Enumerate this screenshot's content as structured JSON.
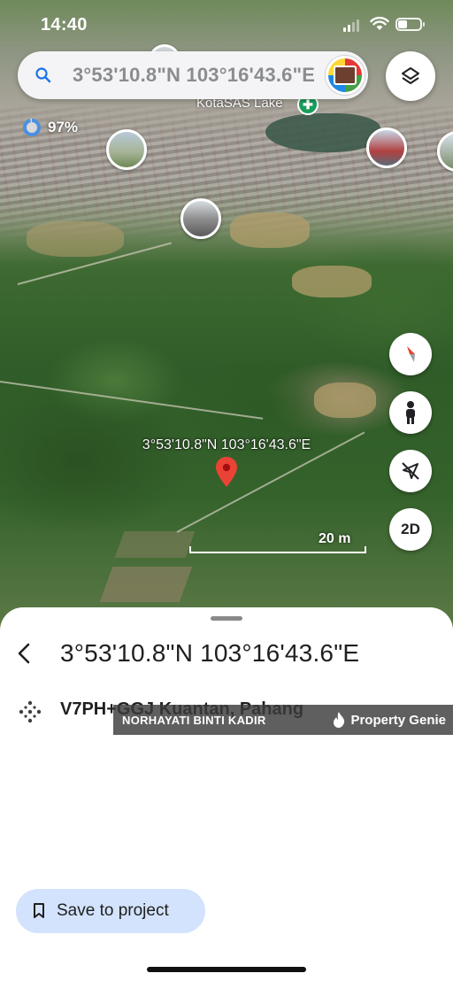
{
  "status_bar": {
    "time": "14:40",
    "battery_level": 0.4
  },
  "search": {
    "query": "3°53'10.8\"N 103°16'43.6\"E"
  },
  "map": {
    "lake_label": "KotaSAS Lake",
    "render_progress": "97%",
    "pin_coordinates": "3°53'10.8\"N 103°16'43.6\"E",
    "scale_label": "20 m",
    "view_mode_button": "2D"
  },
  "place": {
    "title": "3°53'10.8\"N 103°16'43.6\"E",
    "plus_code": "V7PH+GGJ Kuantan, Pahang"
  },
  "watermark": {
    "name": "NORHAYATI BINTI KADIR",
    "brand": "Property Genie"
  },
  "actions": {
    "save_label": "Save to project"
  },
  "icons": {
    "search": "search-icon",
    "layers": "layers-icon",
    "compass": "compass-icon",
    "street_view": "pegman-icon",
    "location": "location-off-icon",
    "back": "back-icon",
    "plus_code": "plus-code-icon",
    "bookmark": "bookmark-icon"
  },
  "colors": {
    "accent": "#1a73e8",
    "save_bg": "#d3e3fd",
    "pin_red": "#ea4335",
    "park_green": "#1b9e5a"
  }
}
